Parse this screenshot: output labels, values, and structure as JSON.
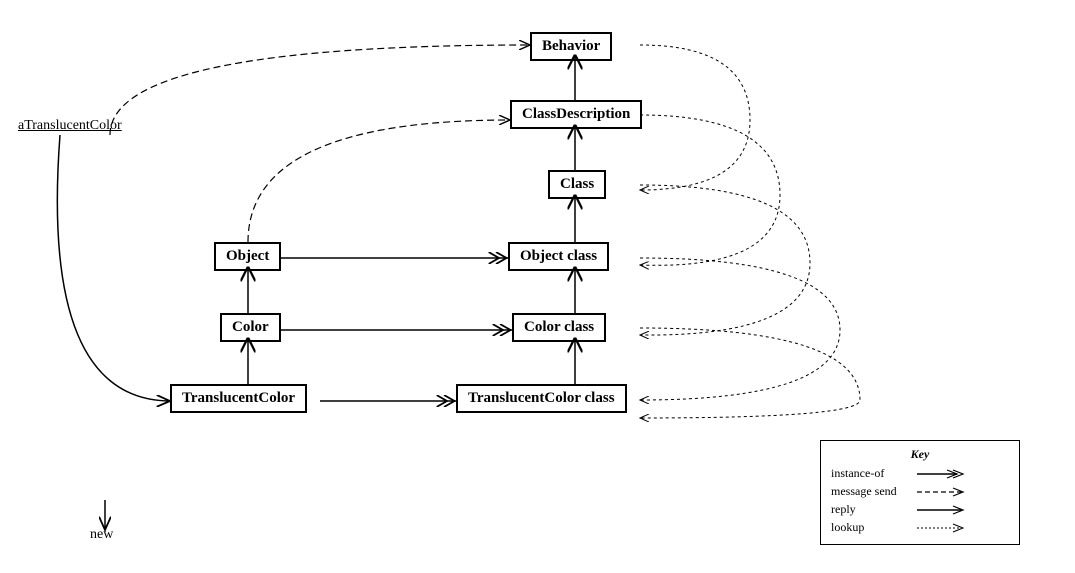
{
  "nodes": {
    "behavior": {
      "label": "Behavior",
      "id": "behavior"
    },
    "classDescription": {
      "label": "ClassDescription",
      "id": "classDescription"
    },
    "class": {
      "label": "Class",
      "id": "class"
    },
    "objectClass": {
      "label": "Object class",
      "id": "objectClass"
    },
    "colorClass": {
      "label": "Color class",
      "id": "colorClass"
    },
    "translucentColorClass": {
      "label": "TranslucentColor class",
      "id": "translucentColorClass"
    },
    "object": {
      "label": "Object",
      "id": "object"
    },
    "color": {
      "label": "Color",
      "id": "color"
    },
    "translucentColor": {
      "label": "TranslucentColor",
      "id": "translucentColor"
    }
  },
  "labels": {
    "aTranslucentColor": "aTranslucentColor",
    "new": "new"
  },
  "key": {
    "title": "Key",
    "items": [
      {
        "label": "instance-of",
        "type": "double-arrow"
      },
      {
        "label": "message send",
        "type": "dashed-arrow"
      },
      {
        "label": "reply",
        "type": "solid-arrow"
      },
      {
        "label": "lookup",
        "type": "dotted-arrow"
      }
    ]
  }
}
